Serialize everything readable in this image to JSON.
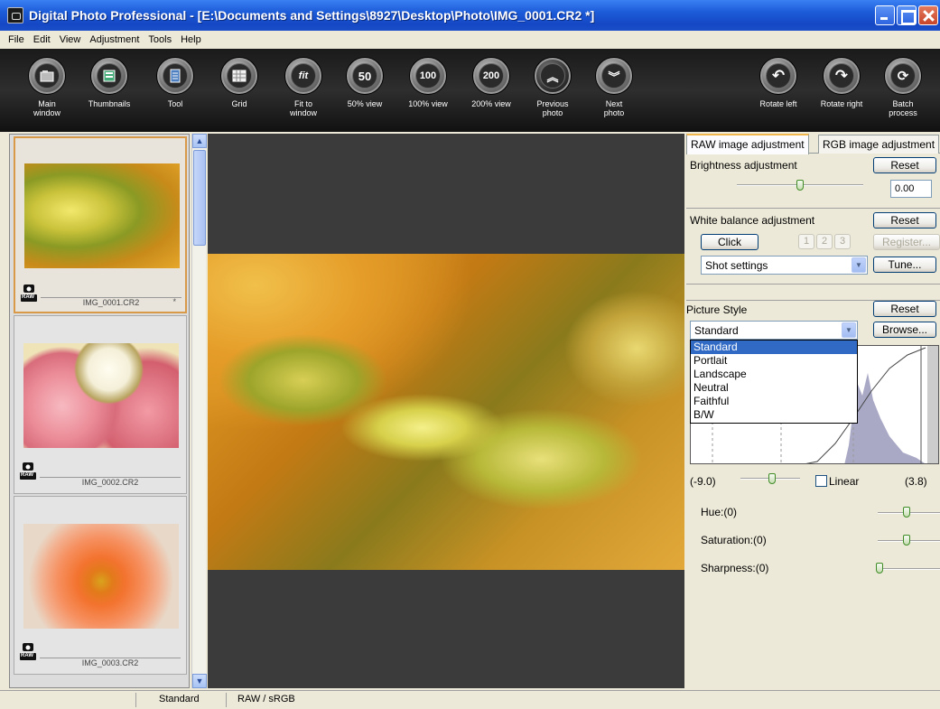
{
  "window": {
    "title": "Digital Photo Professional - [E:\\Documents and Settings\\8927\\Desktop\\Photo\\IMG_0001.CR2 *]"
  },
  "menu": [
    "File",
    "Edit",
    "View",
    "Adjustment",
    "Tools",
    "Help"
  ],
  "toolbar": {
    "buttons": [
      {
        "label": "Main\nwindow",
        "icon": "main-window-icon"
      },
      {
        "label": "Thumbnails",
        "icon": "thumbnails-icon"
      },
      {
        "label": "Tool",
        "icon": "tool-icon"
      },
      {
        "label": "Grid",
        "icon": "grid-icon"
      },
      {
        "label": "Fit to\nwindow",
        "icon": "fit-icon",
        "glyph": "fit"
      },
      {
        "label": "50% view",
        "glyph": "50"
      },
      {
        "label": "100% view",
        "glyph": "100"
      },
      {
        "label": "200% view",
        "glyph": "200"
      },
      {
        "label": "Previous\nphoto",
        "icon": "chevron-up-icon",
        "glyph": "︽"
      },
      {
        "label": "Next\nphoto",
        "icon": "chevron-down-icon",
        "glyph": "︾"
      },
      {
        "label": "Rotate left",
        "icon": "rotate-left-icon",
        "glyph": "↶"
      },
      {
        "label": "Rotate right",
        "icon": "rotate-right-icon",
        "glyph": "↷"
      },
      {
        "label": "Batch\nprocess",
        "icon": "batch-process-icon",
        "glyph": "⟳"
      }
    ]
  },
  "thumbnails": [
    {
      "filename": "IMG_0001.CR2",
      "badge": "RAW",
      "marker": "*"
    },
    {
      "filename": "IMG_0002.CR2",
      "badge": "RAW"
    },
    {
      "filename": "IMG_0003.CR2",
      "badge": "RAW"
    }
  ],
  "tabs": {
    "raw": "RAW image adjustment",
    "rgb": "RGB image adjustment"
  },
  "brightness": {
    "label": "Brightness adjustment",
    "reset": "Reset",
    "value": "0.00"
  },
  "white_balance": {
    "label": "White balance adjustment",
    "reset": "Reset",
    "click": "Click",
    "slots": [
      "1",
      "2",
      "3"
    ],
    "register": "Register...",
    "mode": "Shot settings",
    "tune": "Tune..."
  },
  "picture_style": {
    "label": "Picture Style",
    "reset": "Reset",
    "browse": "Browse...",
    "selected": "Standard",
    "options": [
      "Standard",
      "Portlait",
      "Landscape",
      "Neutral",
      "Faithful",
      "B/W"
    ]
  },
  "contrast": {
    "min": "(-9.0)",
    "max": "(3.8)",
    "linear_label": "Linear"
  },
  "hue": {
    "label": "Hue:(0)"
  },
  "saturation": {
    "label": "Saturation:(0)"
  },
  "sharpness": {
    "label": "Sharpness:(0)"
  },
  "status": {
    "style": "Standard",
    "colorspace": "RAW / sRGB"
  }
}
